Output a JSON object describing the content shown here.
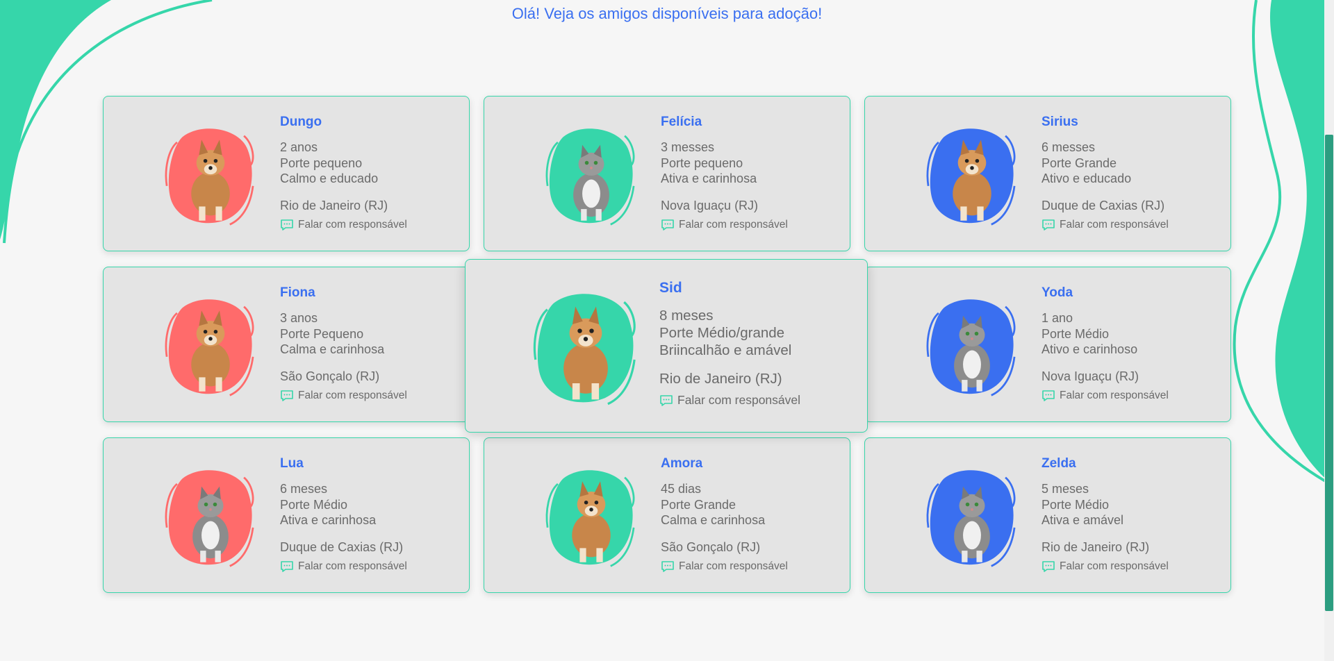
{
  "page": {
    "greeting": "Olá! Veja os amigos disponíveis para adoção!"
  },
  "colors": {
    "accent_green": "#36d6aa",
    "brand_blue": "#3a6ff0",
    "blob_red": "#ff6b6b",
    "blob_green": "#36d6aa",
    "blob_blue": "#3a6ff0",
    "card_background": "#e4e4e4",
    "text_gray": "#6a6a6a"
  },
  "pets": [
    {
      "name": "Dungo",
      "age": "2 anos",
      "size": "Porte pequeno",
      "temperament": "Calmo e educado",
      "city": "Rio de Janeiro (RJ)",
      "contact_label": "Falar com responsável",
      "blob_color": "red",
      "animal": "dog"
    },
    {
      "name": "Felícia",
      "age": "3 messes",
      "size": "Porte pequeno",
      "temperament": "Ativa e carinhosa",
      "city": "Nova Iguaçu (RJ)",
      "contact_label": "Falar com responsável",
      "blob_color": "green",
      "animal": "cat"
    },
    {
      "name": "Sirius",
      "age": "6 messes",
      "size": "Porte Grande",
      "temperament": "Ativo e educado",
      "city": "Duque de Caxias (RJ)",
      "contact_label": "Falar com responsável",
      "blob_color": "blue",
      "animal": "dog"
    },
    {
      "name": "Fiona",
      "age": "3 anos",
      "size": "Porte Pequeno",
      "temperament": "Calma e carinhosa",
      "city": "São Gonçalo (RJ)",
      "contact_label": "Falar com responsável",
      "blob_color": "red",
      "animal": "dog"
    },
    {
      "name": "Sid",
      "age": "8 meses",
      "size": "Porte Médio/grande",
      "temperament": "Briincalhão e amável",
      "city": "Rio de Janeiro (RJ)",
      "contact_label": "Falar com responsável",
      "blob_color": "green",
      "animal": "dog"
    },
    {
      "name": "Yoda",
      "age": "1 ano",
      "size": "Porte Médio",
      "temperament": "Ativo e carinhoso",
      "city": "Nova Iguaçu (RJ)",
      "contact_label": "Falar com responsável",
      "blob_color": "blue",
      "animal": "cat"
    },
    {
      "name": "Lua",
      "age": "6 meses",
      "size": "Porte Médio",
      "temperament": "Ativa e carinhosa",
      "city": "Duque de Caxias (RJ)",
      "contact_label": "Falar com responsável",
      "blob_color": "red",
      "animal": "cat"
    },
    {
      "name": "Amora",
      "age": "45 dias",
      "size": "Porte Grande",
      "temperament": "Calma e carinhosa",
      "city": "São Gonçalo (RJ)",
      "contact_label": "Falar com responsável",
      "blob_color": "green",
      "animal": "dog"
    },
    {
      "name": "Zelda",
      "age": "5 meses",
      "size": "Porte Médio",
      "temperament": "Ativa e amável",
      "city": "Rio de Janeiro (RJ)",
      "contact_label": "Falar com responsável",
      "blob_color": "blue",
      "animal": "cat"
    }
  ]
}
